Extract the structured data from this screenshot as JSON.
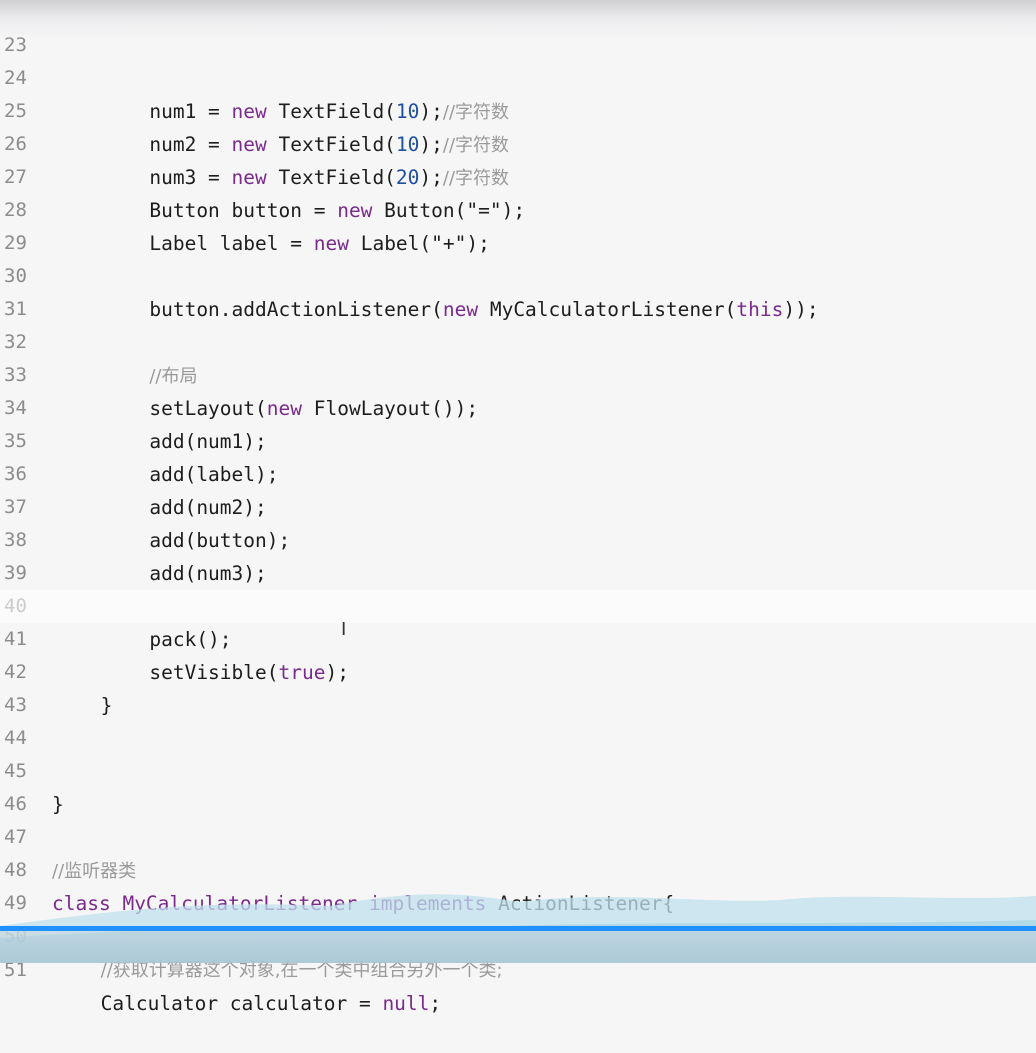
{
  "editor": {
    "lines": [
      {
        "number": "23",
        "code": ""
      },
      {
        "number": "24",
        "code": "        num1 = new TextField(10);//字符数"
      },
      {
        "number": "25",
        "code": "        num2 = new TextField(10);//字符数"
      },
      {
        "number": "26",
        "code": "        num3 = new TextField(20);//字符数"
      },
      {
        "number": "27",
        "code": "        Button button = new Button(\"=\");"
      },
      {
        "number": "28",
        "code": "        Label label = new Label(\"+\");"
      },
      {
        "number": "29",
        "code": ""
      },
      {
        "number": "30",
        "code": "        button.addActionListener(new MyCalculatorListener(this));"
      },
      {
        "number": "31",
        "code": ""
      },
      {
        "number": "32",
        "code": "        //布局"
      },
      {
        "number": "33",
        "code": "        setLayout(new FlowLayout());"
      },
      {
        "number": "34",
        "code": "        add(num1);"
      },
      {
        "number": "35",
        "code": "        add(label);"
      },
      {
        "number": "36",
        "code": "        add(num2);"
      },
      {
        "number": "37",
        "code": "        add(button);"
      },
      {
        "number": "38",
        "code": "        add(num3);"
      },
      {
        "number": "39",
        "code": ""
      },
      {
        "number": "40",
        "code": "        pack();"
      },
      {
        "number": "41",
        "code": "        setVisible(true);"
      },
      {
        "number": "42",
        "code": "    }"
      },
      {
        "number": "43",
        "code": ""
      },
      {
        "number": "44",
        "code": ""
      },
      {
        "number": "45",
        "code": "}"
      },
      {
        "number": "46",
        "code": ""
      },
      {
        "number": "47",
        "code": "//监听器类"
      },
      {
        "number": "48",
        "code": "class MyCalculatorListener implements ActionListener{"
      },
      {
        "number": "49",
        "code": ""
      },
      {
        "number": "50",
        "code": "    //获取计算器这个对象,在一个类中组合另外一个类;"
      },
      {
        "number": "51",
        "code": "    Calculator calculator = null;"
      }
    ]
  },
  "colors": {
    "background": "#f6f6f7",
    "keyword": "#7a2a8c",
    "number": "#1f4fa0",
    "comment": "#9a9a9a",
    "line_number": "#8c8c8c",
    "progress": "#1e90ff"
  }
}
